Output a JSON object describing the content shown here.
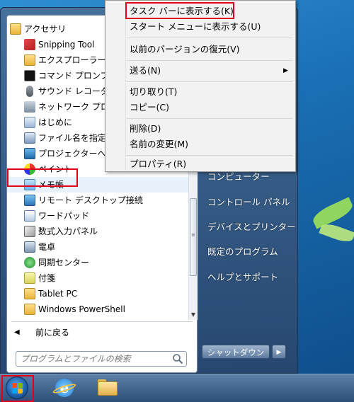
{
  "programs": {
    "folder_accessories": "アクセサリ",
    "items": [
      "Snipping Tool",
      "エクスプローラー",
      "コマンド プロンプト",
      "サウンド レコーダー",
      "ネットワーク プロジェクター",
      "はじめに",
      "ファイル名を指定して実行",
      "プロジェクターへの接続",
      "ペイント",
      "メモ帳",
      "リモート デスクトップ接続",
      "ワードパッド",
      "数式入力パネル",
      "電卓",
      "同期センター",
      "付箋",
      "Tablet PC",
      "Windows PowerShell"
    ],
    "back_label": "前に戻る"
  },
  "search": {
    "placeholder": "プログラムとファイルの検索"
  },
  "right_pane": {
    "computer": "コンピューター",
    "control_panel": "コントロール パネル",
    "devices_printers": "デバイスとプリンター",
    "default_programs": "既定のプログラム",
    "help_support": "ヘルプとサポート",
    "shutdown": "シャットダウン"
  },
  "context_menu": {
    "pin_taskbar": "タスク バーに表示する(K)",
    "pin_start": "スタート メニューに表示する(U)",
    "restore_previous": "以前のバージョンの復元(V)",
    "send_to": "送る(N)",
    "cut": "切り取り(T)",
    "copy": "コピー(C)",
    "delete": "削除(D)",
    "rename": "名前の変更(M)",
    "properties": "プロパティ(R)"
  },
  "colors": {
    "highlight_box": "#e0001b",
    "accent": "#1e6aa3"
  }
}
